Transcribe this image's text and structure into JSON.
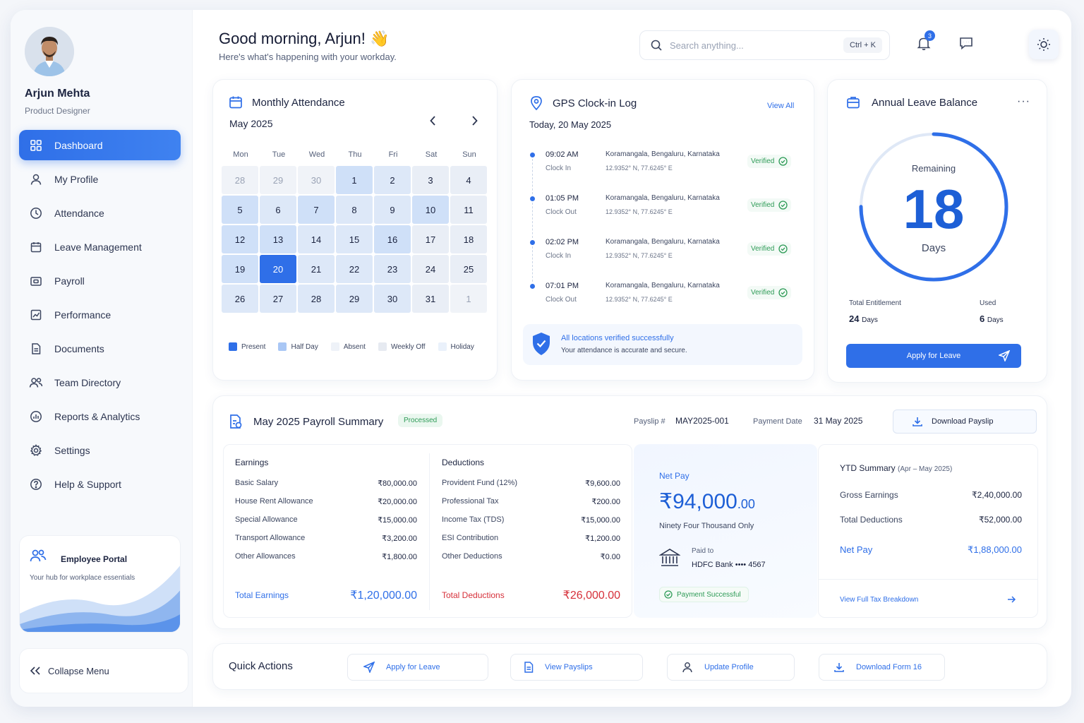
{
  "user": {
    "name": "Arjun Mehta",
    "role": "Product Designer"
  },
  "sidebar": {
    "items": [
      {
        "label": "Dashboard",
        "icon": "grid-icon"
      },
      {
        "label": "My Profile",
        "icon": "user-icon"
      },
      {
        "label": "Attendance",
        "icon": "clock-icon"
      },
      {
        "label": "Leave Management",
        "icon": "calendar-icon"
      },
      {
        "label": "Payroll",
        "icon": "wallet-icon"
      },
      {
        "label": "Performance",
        "icon": "chart-icon"
      },
      {
        "label": "Documents",
        "icon": "document-icon"
      },
      {
        "label": "Team Directory",
        "icon": "team-icon"
      },
      {
        "label": "Reports & Analytics",
        "icon": "bar-chart-icon"
      },
      {
        "label": "Settings",
        "icon": "gear-icon"
      },
      {
        "label": "Help & Support",
        "icon": "help-icon"
      }
    ],
    "portal": {
      "title": "Employee Portal",
      "subtitle": "Your hub for workplace essentials"
    },
    "collapse": "Collapse Menu"
  },
  "header": {
    "greeting": "Good morning, Arjun! 👋",
    "subtitle": "Here's what's happening with your workday.",
    "search_placeholder": "Search anything...",
    "shortcut": "Ctrl + K",
    "notification_count": "3"
  },
  "attendance": {
    "title": "Monthly Attendance",
    "month": "May 2025",
    "weekdays": [
      "Mon",
      "Tue",
      "Wed",
      "Thu",
      "Fri",
      "Sat",
      "Sun"
    ],
    "days": [
      {
        "d": "28",
        "s": "x"
      },
      {
        "d": "29",
        "s": "x"
      },
      {
        "d": "30",
        "s": "x"
      },
      {
        "d": "1",
        "s": "p"
      },
      {
        "d": "2",
        "s": "h"
      },
      {
        "d": "3",
        "s": "o"
      },
      {
        "d": "4",
        "s": "o"
      },
      {
        "d": "5",
        "s": "p"
      },
      {
        "d": "6",
        "s": "h"
      },
      {
        "d": "7",
        "s": "p"
      },
      {
        "d": "8",
        "s": "h"
      },
      {
        "d": "9",
        "s": "h"
      },
      {
        "d": "10",
        "s": "p"
      },
      {
        "d": "11",
        "s": "o"
      },
      {
        "d": "12",
        "s": "p"
      },
      {
        "d": "13",
        "s": "p"
      },
      {
        "d": "14",
        "s": "h"
      },
      {
        "d": "15",
        "s": "h"
      },
      {
        "d": "16",
        "s": "p"
      },
      {
        "d": "17",
        "s": "o"
      },
      {
        "d": "18",
        "s": "o"
      },
      {
        "d": "19",
        "s": "p"
      },
      {
        "d": "20",
        "s": "sel"
      },
      {
        "d": "21",
        "s": "h"
      },
      {
        "d": "22",
        "s": "h"
      },
      {
        "d": "23",
        "s": "h"
      },
      {
        "d": "24",
        "s": "o"
      },
      {
        "d": "25",
        "s": "o"
      },
      {
        "d": "26",
        "s": "h"
      },
      {
        "d": "27",
        "s": "h"
      },
      {
        "d": "28",
        "s": "h"
      },
      {
        "d": "29",
        "s": "h"
      },
      {
        "d": "30",
        "s": "h"
      },
      {
        "d": "31",
        "s": "o"
      },
      {
        "d": "1",
        "s": "x"
      }
    ],
    "legend": [
      {
        "label": "Present",
        "color": "#2f6fe8"
      },
      {
        "label": "Half Day",
        "color": "#a9c7f5"
      },
      {
        "label": "Absent",
        "color": "#eef2f8"
      },
      {
        "label": "Weekly Off",
        "color": "#e6eaf1"
      },
      {
        "label": "Holiday",
        "color": "#eaf1fb"
      }
    ]
  },
  "gps": {
    "title": "GPS Clock-in Log",
    "view_all": "View All",
    "date": "Today, 20 May 2025",
    "entries": [
      {
        "time": "09:02 AM",
        "type": "Clock In",
        "location": "Koramangala, Bengaluru, Karnataka",
        "coords": "12.9352° N, 77.6245° E",
        "status": "Verified"
      },
      {
        "time": "01:05 PM",
        "type": "Clock Out",
        "location": "Koramangala, Bengaluru, Karnataka",
        "coords": "12.9352° N, 77.6245° E",
        "status": "Verified"
      },
      {
        "time": "02:02 PM",
        "type": "Clock In",
        "location": "Koramangala, Bengaluru, Karnataka",
        "coords": "12.9352° N, 77.6245° E",
        "status": "Verified"
      },
      {
        "time": "07:01 PM",
        "type": "Clock Out",
        "location": "Koramangala, Bengaluru, Karnataka",
        "coords": "12.9352° N, 77.6245° E",
        "status": "Verified"
      }
    ],
    "banner_title": "All locations verified successfully",
    "banner_sub": "Your attendance is accurate and secure."
  },
  "leave": {
    "title": "Annual Leave Balance",
    "remaining_label": "Remaining",
    "remaining": "18",
    "days_label": "Days",
    "remaining_fraction": 0.75,
    "total_label": "Total Entitlement",
    "total_value": "24",
    "used_label": "Used",
    "used_value": "6",
    "unit": "Days",
    "apply": "Apply for Leave"
  },
  "payroll": {
    "title": "May 2025 Payroll Summary",
    "status": "Processed",
    "payslip_label": "Payslip #",
    "payslip_no": "MAY2025-001",
    "payment_date_label": "Payment Date",
    "payment_date": "31 May 2025",
    "download": "Download Payslip",
    "earnings_title": "Earnings",
    "earnings": [
      {
        "label": "Basic Salary",
        "value": "₹80,000.00"
      },
      {
        "label": "House Rent Allowance",
        "value": "₹20,000.00"
      },
      {
        "label": "Special Allowance",
        "value": "₹15,000.00"
      },
      {
        "label": "Transport Allowance",
        "value": "₹3,200.00"
      },
      {
        "label": "Other Allowances",
        "value": "₹1,800.00"
      }
    ],
    "total_earnings_label": "Total Earnings",
    "total_earnings": "₹1,20,000.00",
    "deductions_title": "Deductions",
    "deductions": [
      {
        "label": "Provident Fund (12%)",
        "value": "₹9,600.00"
      },
      {
        "label": "Professional Tax",
        "value": "₹200.00"
      },
      {
        "label": "Income Tax (TDS)",
        "value": "₹15,000.00"
      },
      {
        "label": "ESI Contribution",
        "value": "₹1,200.00"
      },
      {
        "label": "Other Deductions",
        "value": "₹0.00"
      }
    ],
    "total_deductions_label": "Total Deductions",
    "total_deductions": "₹26,000.00",
    "net_label": "Net Pay",
    "net_main": "₹94,000",
    "net_dec": ".00",
    "net_words": "Ninety Four Thousand Only",
    "paid_to_label": "Paid to",
    "paid_to": "HDFC Bank •••• 4567",
    "payment_status": "Payment Successful",
    "ytd_title": "YTD Summary",
    "ytd_range": "(Apr – May 2025)",
    "ytd_gross_label": "Gross Earnings",
    "ytd_gross": "₹2,40,000.00",
    "ytd_ded_label": "Total Deductions",
    "ytd_ded": "₹52,000.00",
    "ytd_net_label": "Net Pay",
    "ytd_net": "₹1,88,000.00",
    "ytd_link": "View Full Tax Breakdown"
  },
  "quick": {
    "title": "Quick Actions",
    "actions": [
      "Apply for Leave",
      "View Payslips",
      "Update Profile",
      "Download Form 16"
    ]
  },
  "colors": {
    "accent": "#2f6fe8",
    "success": "#2e9b57",
    "danger": "#d6303a"
  }
}
